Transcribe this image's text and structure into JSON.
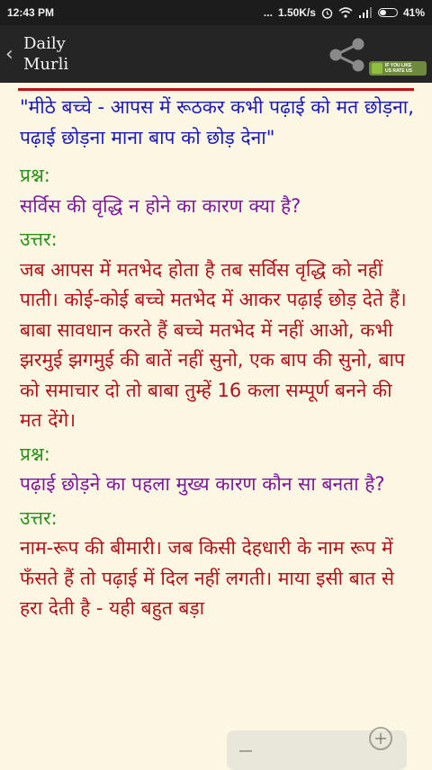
{
  "status": {
    "time": "12:43 PM",
    "dots": "...",
    "speed": "1.50K/s",
    "battery": "41%",
    "battery_level": 0.41
  },
  "app": {
    "title_line1": "Daily",
    "title_line2": "Murli",
    "like_text_1": "IF YOU LIKE",
    "like_text_2": "US RATE US"
  },
  "content": {
    "title": "\"मीठे बच्चे - आपस में रूठकर कभी पढ़ाई को मत छोड़ना, पढ़ाई छोड़ना माना बाप को छोड़ देना\"",
    "q1_label": "प्रश्न:",
    "q1": "सर्विस की वृद्धि न होने का कारण क्या है?",
    "a1_label": "उत्तर:",
    "a1": "जब आपस में मतभेद होता है तब सर्विस वृद्धि को नहीं पाती। कोई-कोई बच्चे मतभेद में आकर पढ़ाई छोड़ देते हैं। बाबा सावधान करते हैं बच्चे मतभेद में नहीं आओ, कभी झरमुई झगमुई की बातें नहीं सुनो, एक बाप की सुनो, बाप को समाचार दो तो बाबा तुम्हें 16 कला सम्पूर्ण बनने की मत देंगे।",
    "q2_label": "प्रश्न:",
    "q2": "पढ़ाई छोड़ने का पहला मुख्य कारण कौन सा बनता है?",
    "a2_label": "उत्तर:",
    "a2": "नाम-रूप की बीमारी। जब किसी देहधारी के नाम रूप में फँसते हैं तो पढ़ाई में दिल नहीं लगती। माया इसी बात से हरा देती है - यही बहुत बड़ा"
  },
  "colors": {
    "title": "#1a1ab8",
    "label": "#2f8f1a",
    "question": "#7a1a9a",
    "answer": "#b3121a",
    "divider": "#c01010"
  }
}
